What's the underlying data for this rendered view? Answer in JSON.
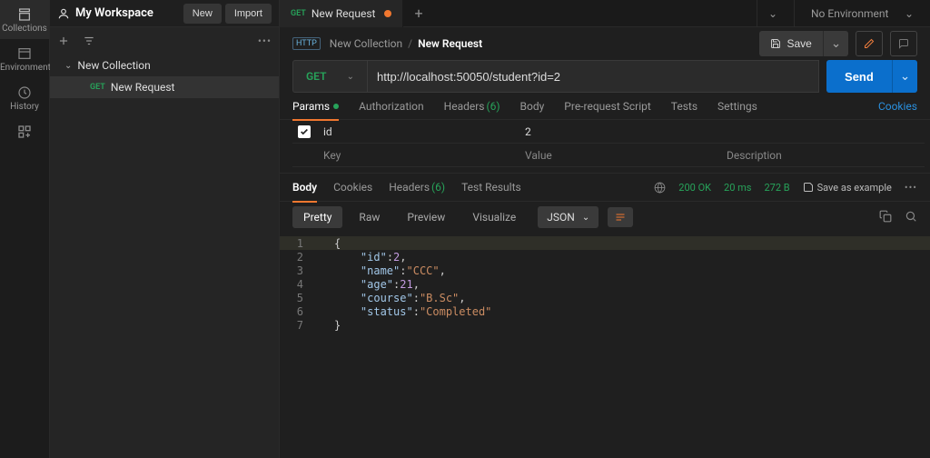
{
  "workspace": {
    "title": "My Workspace",
    "new_btn": "New",
    "import_btn": "Import"
  },
  "rail": {
    "collections": "Collections",
    "environments": "Environments",
    "history": "History"
  },
  "tree": {
    "collection": "New Collection",
    "items": [
      {
        "method": "GET",
        "name": "New Request"
      }
    ]
  },
  "tab": {
    "method": "GET",
    "name": "New Request"
  },
  "env": {
    "none": "No Environment"
  },
  "breadcrumb": {
    "collection": "New Collection",
    "request": "New Request"
  },
  "save": {
    "label": "Save"
  },
  "request": {
    "method": "GET",
    "url": "http://localhost:50050/student?id=2",
    "send": "Send"
  },
  "req_tabs": {
    "params": "Params",
    "auth": "Authorization",
    "headers_label": "Headers",
    "headers_count": "(6)",
    "body": "Body",
    "prereq": "Pre-request Script",
    "tests": "Tests",
    "settings": "Settings",
    "cookies": "Cookies"
  },
  "params_table": {
    "row": {
      "key": "id",
      "value": "2",
      "desc": ""
    },
    "placeholders": {
      "key": "Key",
      "value": "Value",
      "desc": "Description"
    }
  },
  "res_tabs": {
    "body": "Body",
    "cookies": "Cookies",
    "headers_label": "Headers",
    "headers_count": "(6)",
    "tests": "Test Results",
    "status_code": "200",
    "status_text": "OK",
    "time": "20 ms",
    "size": "272 B",
    "save_example": "Save as example"
  },
  "view": {
    "pretty": "Pretty",
    "raw": "Raw",
    "preview": "Preview",
    "visualize": "Visualize",
    "format": "JSON"
  },
  "response_json": {
    "id": 2,
    "name": "CCC",
    "age": 21,
    "course": "B.Sc",
    "status": "Completed"
  },
  "code_lines": [
    {
      "n": "1",
      "tokens": [
        {
          "t": "p",
          "v": "{"
        }
      ]
    },
    {
      "n": "2",
      "tokens": [
        {
          "t": "i",
          "v": "    "
        },
        {
          "t": "k",
          "v": "\"id\""
        },
        {
          "t": "p",
          "v": ": "
        },
        {
          "t": "n",
          "v": "2"
        },
        {
          "t": "p",
          "v": ","
        }
      ]
    },
    {
      "n": "3",
      "tokens": [
        {
          "t": "i",
          "v": "    "
        },
        {
          "t": "k",
          "v": "\"name\""
        },
        {
          "t": "p",
          "v": ": "
        },
        {
          "t": "s",
          "v": "\"CCC\""
        },
        {
          "t": "p",
          "v": ","
        }
      ]
    },
    {
      "n": "4",
      "tokens": [
        {
          "t": "i",
          "v": "    "
        },
        {
          "t": "k",
          "v": "\"age\""
        },
        {
          "t": "p",
          "v": ": "
        },
        {
          "t": "n",
          "v": "21"
        },
        {
          "t": "p",
          "v": ","
        }
      ]
    },
    {
      "n": "5",
      "tokens": [
        {
          "t": "i",
          "v": "    "
        },
        {
          "t": "k",
          "v": "\"course\""
        },
        {
          "t": "p",
          "v": ": "
        },
        {
          "t": "s",
          "v": "\"B.Sc\""
        },
        {
          "t": "p",
          "v": ","
        }
      ]
    },
    {
      "n": "6",
      "tokens": [
        {
          "t": "i",
          "v": "    "
        },
        {
          "t": "k",
          "v": "\"status\""
        },
        {
          "t": "p",
          "v": ": "
        },
        {
          "t": "s",
          "v": "\"Completed\""
        }
      ]
    },
    {
      "n": "7",
      "tokens": [
        {
          "t": "p",
          "v": "}"
        }
      ]
    }
  ]
}
